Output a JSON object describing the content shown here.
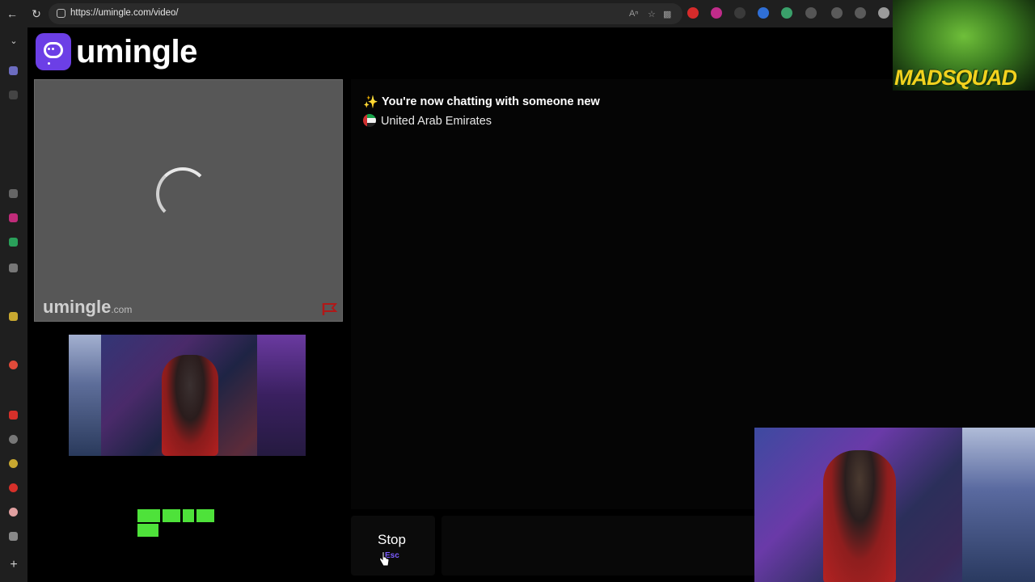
{
  "browser": {
    "url": "https://umingle.com/video/"
  },
  "app": {
    "logo_text": "umingle",
    "watermark_main": "umingle",
    "watermark_suffix": ".com"
  },
  "chat": {
    "status_title": "You're now chatting with someone new",
    "country": "United Arab Emirates"
  },
  "controls": {
    "stop_label": "Stop",
    "stop_shortcut": "Esc"
  },
  "overlay": {
    "madsquad_text": "MADSQUAD"
  },
  "colors": {
    "brand_purple": "#6c3fe6",
    "shortcut_purple": "#7c5cff",
    "green_logo": "#4ee23a"
  }
}
